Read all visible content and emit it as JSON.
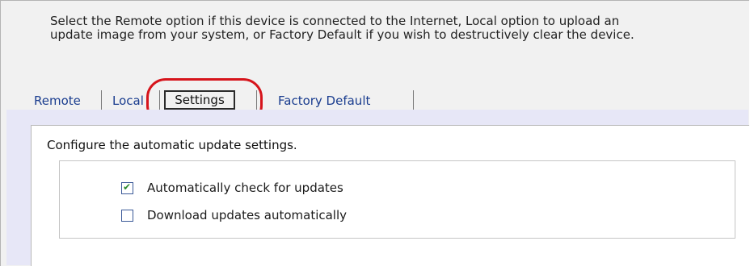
{
  "intro": {
    "line1": "Select the Remote option if this device is connected to the Internet, Local option to upload an",
    "line2": "update image from your system, or Factory Default if you wish to destructively clear the device."
  },
  "tabs": [
    {
      "label": "Remote",
      "active": false
    },
    {
      "label": "Local",
      "active": false
    },
    {
      "label": "Settings",
      "active": true
    },
    {
      "label": "Factory Default",
      "active": false
    }
  ],
  "settings_panel": {
    "title": "Configure the automatic update settings.",
    "options": [
      {
        "label": "Automatically check for updates",
        "checked": true
      },
      {
        "label": "Download updates automatically",
        "checked": false
      }
    ]
  },
  "colors": {
    "highlight": "#d6141b",
    "tab_link": "#1a3d8f",
    "panel_bg": "#e7e7f7"
  }
}
